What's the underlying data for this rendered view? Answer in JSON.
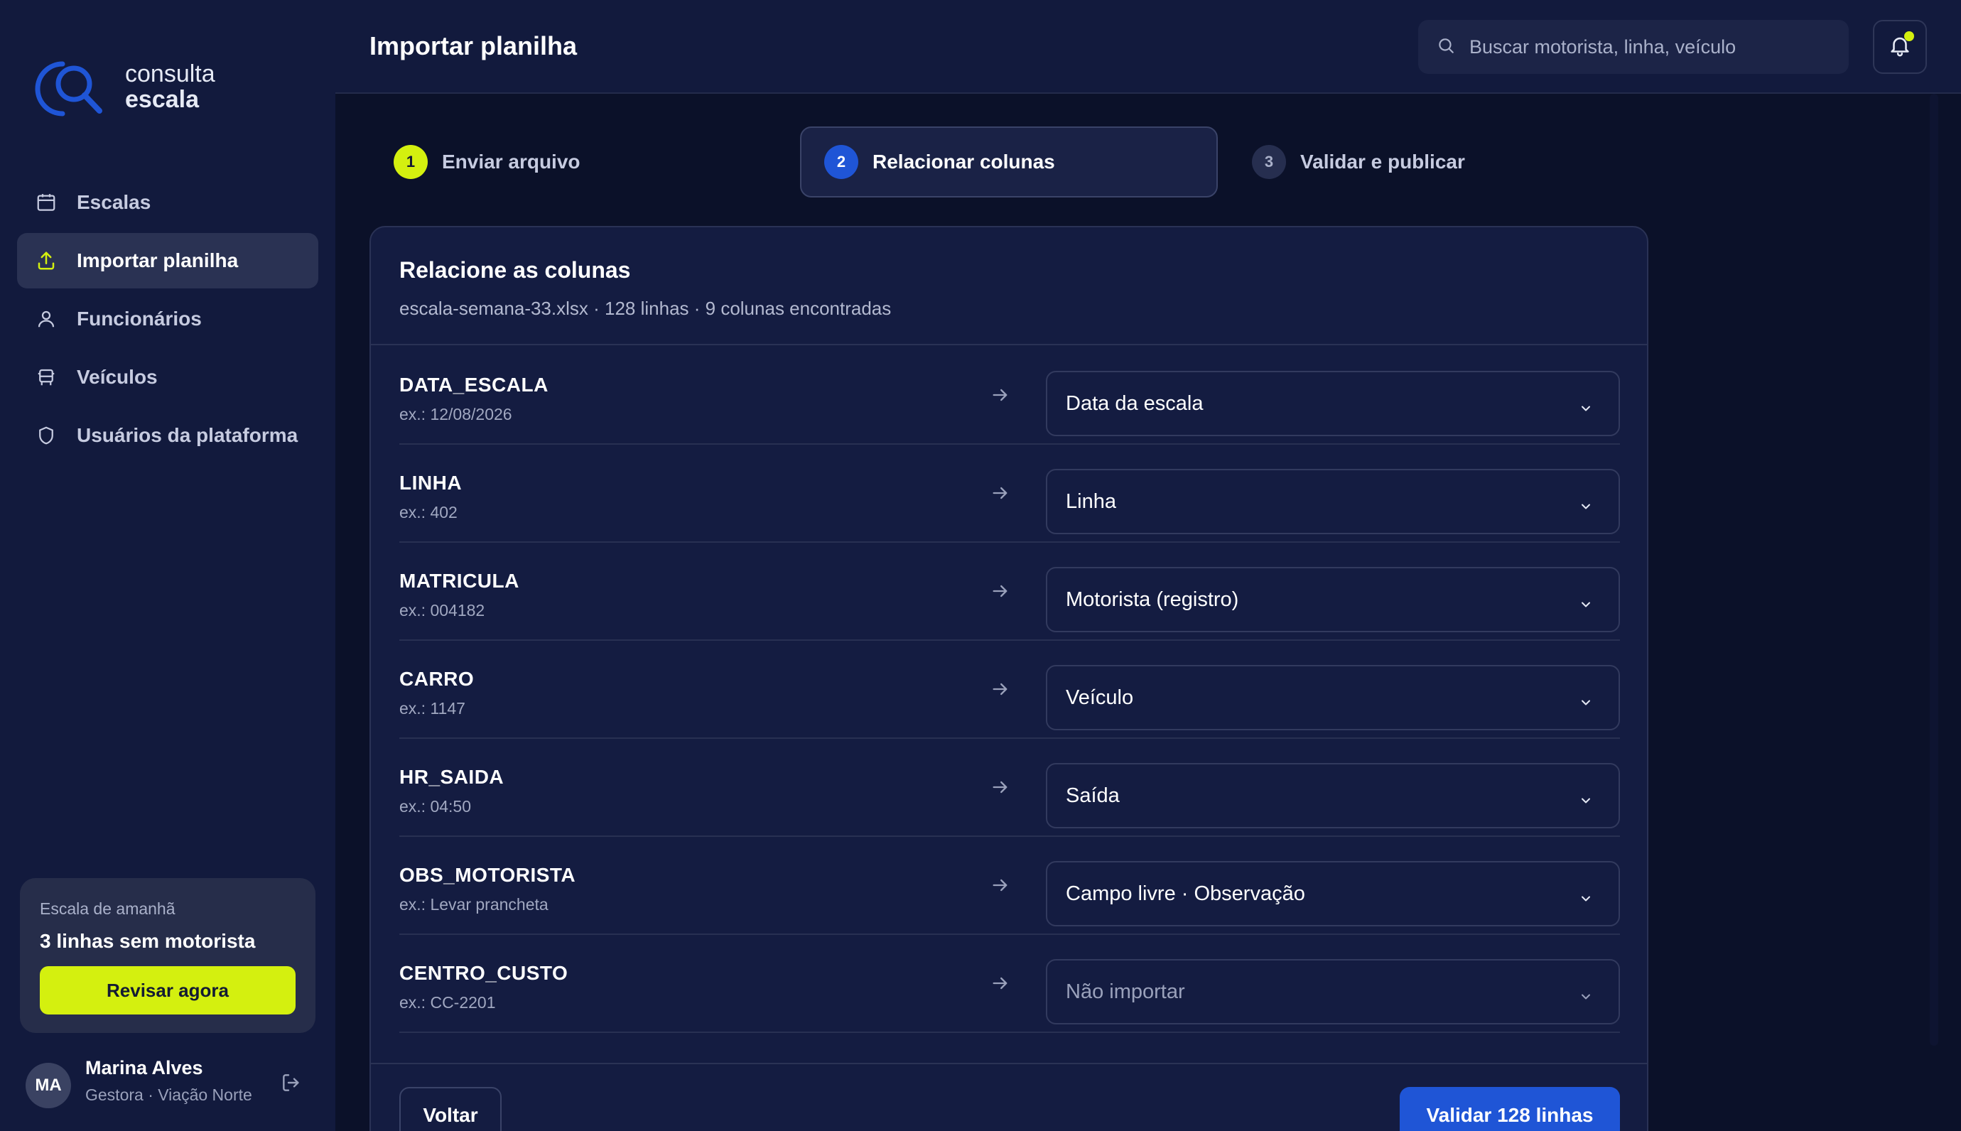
{
  "brand": {
    "line1": "consulta",
    "line2": "escala"
  },
  "sidebar": {
    "items": [
      {
        "label": "Escalas",
        "icon": "calendar-icon"
      },
      {
        "label": "Importar planilha",
        "icon": "upload-icon",
        "active": true
      },
      {
        "label": "Funcionários",
        "icon": "user-icon"
      },
      {
        "label": "Veículos",
        "icon": "bus-icon"
      },
      {
        "label": "Usuários da plataforma",
        "icon": "shield-icon"
      }
    ],
    "promo": {
      "caption": "Escala de amanhã",
      "message": "3 linhas sem motorista",
      "button": "Revisar agora"
    },
    "user": {
      "initials": "MA",
      "name": "Marina Alves",
      "role": "Gestora · Viação Norte"
    }
  },
  "header": {
    "title": "Importar planilha",
    "search_placeholder": "Buscar motorista, linha, veículo"
  },
  "stepper": [
    {
      "num": "1",
      "label": "Enviar arquivo",
      "state": "done"
    },
    {
      "num": "2",
      "label": "Relacionar colunas",
      "state": "current"
    },
    {
      "num": "3",
      "label": "Validar e publicar",
      "state": "pending"
    }
  ],
  "card": {
    "title": "Relacione as colunas",
    "subtitle": "escala-semana-33.xlsx · 128 linhas · 9 colunas encontradas",
    "rows": [
      {
        "column": "DATA_ESCALA",
        "example": "ex.: 12/08/2026",
        "mapping": "Data da escala"
      },
      {
        "column": "LINHA",
        "example": "ex.: 402",
        "mapping": "Linha"
      },
      {
        "column": "MATRICULA",
        "example": "ex.: 004182",
        "mapping": "Motorista (registro)"
      },
      {
        "column": "CARRO",
        "example": "ex.: 1147",
        "mapping": "Veículo"
      },
      {
        "column": "HR_SAIDA",
        "example": "ex.: 04:50",
        "mapping": "Saída"
      },
      {
        "column": "OBS_MOTORISTA",
        "example": "ex.: Levar prancheta",
        "mapping": "Campo livre · Observação"
      },
      {
        "column": "CENTRO_CUSTO",
        "example": "ex.: CC-2201",
        "mapping": "Não importar"
      }
    ],
    "back_button": "Voltar",
    "validate_button": "Validar 128 linhas"
  },
  "colors": {
    "accent_lime": "#d4f00f",
    "primary_blue": "#1f55d6",
    "sidebar_bg": "#121a3d",
    "page_bg": "#0b1129"
  }
}
